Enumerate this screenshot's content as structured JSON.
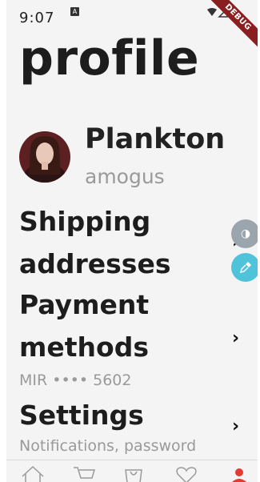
{
  "status_bar": {
    "time": "9:07",
    "notif_glyph": "A",
    "debug_banner": "DEBUG"
  },
  "page": {
    "title": "profile"
  },
  "user": {
    "name": "Plankton",
    "handle": "amogus"
  },
  "menu": {
    "shipping": {
      "title_line1": "Shipping",
      "title_line2": "addresses"
    },
    "payment": {
      "title_line1": "Payment",
      "title_line2": "methods",
      "subtitle": "MIR •••• 5602"
    },
    "settings": {
      "title": "Settings",
      "subtitle": "Notifications, password"
    },
    "chevron": "›"
  },
  "floating": {
    "contrast_icon": "◑",
    "eyedropper_icon": "eyedropper-icon"
  },
  "bottom_nav": {
    "items": [
      "home-icon",
      "cart-icon",
      "bag-icon",
      "favorites-icon",
      "profile-icon"
    ],
    "active_color": "#e53935"
  }
}
